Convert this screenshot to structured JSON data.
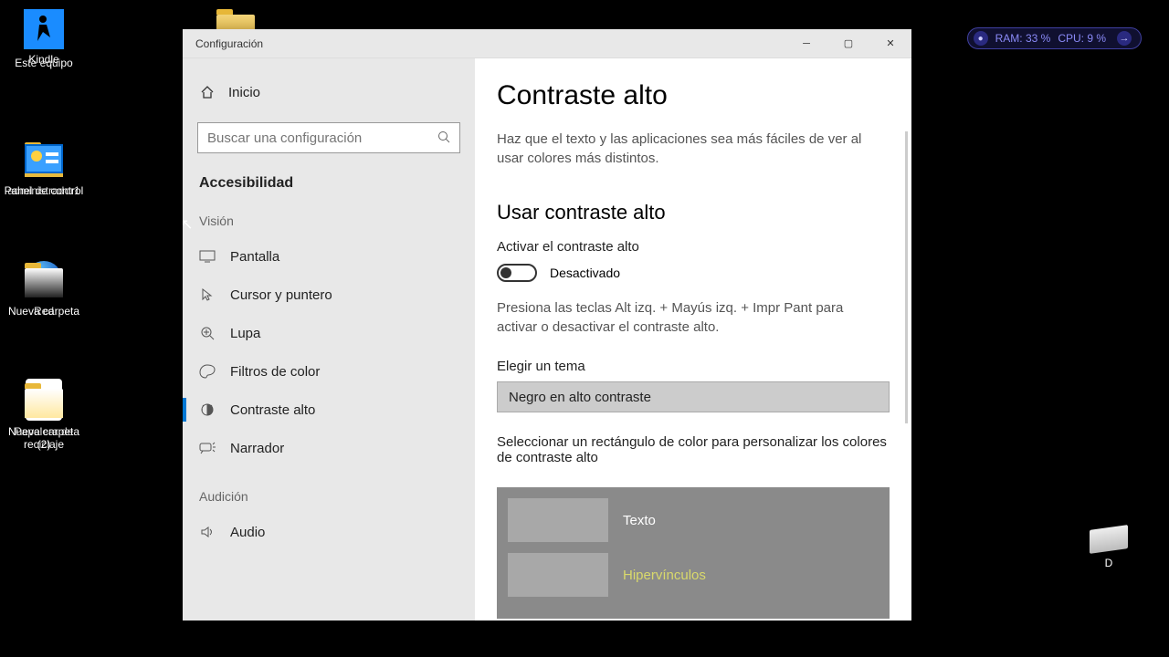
{
  "desktop": {
    "icons": [
      {
        "label": "Este equipo",
        "name": "desktop-icon-thispc"
      },
      {
        "label": "Kindle",
        "name": "desktop-icon-kindle"
      },
      {
        "label": "administrador1",
        "name": "desktop-icon-admin"
      },
      {
        "label": "Panel de control",
        "name": "desktop-icon-controlpanel"
      },
      {
        "label": "Red",
        "name": "desktop-icon-network"
      },
      {
        "label": "Nueva carpeta",
        "name": "desktop-icon-newfolder1"
      },
      {
        "label": "Papelera de reciclaje",
        "name": "desktop-icon-recyclebin"
      },
      {
        "label": "Nueva carpeta (2)",
        "name": "desktop-icon-newfolder2"
      }
    ],
    "top_folder": ""
  },
  "window": {
    "title": "Configuración",
    "home": "Inicio",
    "search_placeholder": "Buscar una configuración",
    "section_title": "Accesibilidad",
    "group_vision": "Visión",
    "group_audio": "Audición",
    "nav": {
      "pantalla": "Pantalla",
      "cursor": "Cursor y puntero",
      "lupa": "Lupa",
      "filtros": "Filtros de color",
      "contraste": "Contraste alto",
      "narrador": "Narrador",
      "audio": "Audio"
    }
  },
  "content": {
    "title": "Contraste alto",
    "desc": "Haz que el texto y las aplicaciones sea más fáciles de ver al usar colores más distintos.",
    "use_title": "Usar contraste alto",
    "toggle_label": "Activar el contraste alto",
    "toggle_state": "Desactivado",
    "hint": "Presiona las teclas Alt izq. + Mayús izq. + Impr Pant para activar o desactivar el contraste alto.",
    "theme_label": "Elegir un tema",
    "theme_selected": "Negro en alto contraste",
    "customize_label": "Seleccionar un rectángulo de color para personalizar los colores de contraste alto",
    "color_rows": {
      "texto": "Texto",
      "hyper": "Hipervínculos"
    }
  },
  "drive": {
    "label": "D"
  },
  "stats": {
    "ram": "RAM: 33 %",
    "cpu": "CPU: 9 %"
  }
}
